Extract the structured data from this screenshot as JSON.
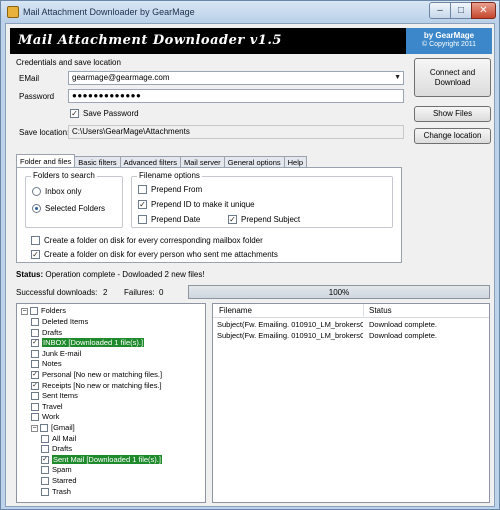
{
  "window": {
    "title": "Mail Attachment Downloader by GearMage",
    "minimize_glyph": "–",
    "maximize_glyph": "□",
    "close_glyph": "✕"
  },
  "banner": {
    "title": "Mail Attachment Downloader v1.5",
    "brand": "by GearMage",
    "copyright": "© Copyright 2011"
  },
  "credentials": {
    "section_label": "Credentials and save location",
    "email_label": "EMail",
    "email_value": "gearmage@gearmage.com",
    "password_label": "Password",
    "password_value": "●●●●●●●●●●●●●",
    "save_password_label": "Save Password",
    "save_password_checked": true,
    "save_location_label": "Save location:",
    "save_location_value": "C:\\Users\\GearMage\\Attachments"
  },
  "buttons": {
    "connect": "Connect and Download",
    "show_files": "Show Files",
    "change_location": "Change location"
  },
  "tabs": [
    {
      "label": "Folder and files",
      "active": true
    },
    {
      "label": "Basic filters",
      "active": false
    },
    {
      "label": "Advanced filters",
      "active": false
    },
    {
      "label": "Mail server",
      "active": false
    },
    {
      "label": "General options",
      "active": false
    },
    {
      "label": "Help",
      "active": false
    }
  ],
  "folders_to_search": {
    "title": "Folders to search",
    "options": [
      "Inbox only",
      "Selected Folders"
    ],
    "selected": "Selected Folders"
  },
  "filename_options": {
    "title": "Filename options",
    "prepend_from": {
      "label": "Prepend From",
      "checked": false
    },
    "prepend_id": {
      "label": "Prepend ID to make it unique",
      "checked": true
    },
    "prepend_date": {
      "label": "Prepend Date",
      "checked": false
    },
    "prepend_subject": {
      "label": "Prepend Subject",
      "checked": true
    }
  },
  "folder_options": {
    "per_mailbox": {
      "label": "Create a folder on disk for every corresponding mailbox folder",
      "checked": false
    },
    "per_sender": {
      "label": "Create a folder on disk for every person who sent me attachments",
      "checked": true
    }
  },
  "status": {
    "label": "Status:",
    "text": "Operation complete - Dowloaded 2 new files!",
    "successful_label": "Successful downloads:",
    "successful_count": "2",
    "failures_label": "Failures:",
    "failures_count": "0",
    "progress_text": "100%",
    "progress_fraction": 1.0
  },
  "tree": {
    "root": "Folders",
    "expander_glyph": "−",
    "checkmark_glyph": "✓",
    "items": [
      {
        "label": "Deleted Items",
        "level": 1,
        "checked": false,
        "highlight": false
      },
      {
        "label": "Drafts",
        "level": 1,
        "checked": false,
        "highlight": false
      },
      {
        "label": "INBOX [Downloaded 1 file(s).]",
        "level": 1,
        "checked": true,
        "highlight": true
      },
      {
        "label": "Junk E-mail",
        "level": 1,
        "checked": false,
        "highlight": false
      },
      {
        "label": "Notes",
        "level": 1,
        "checked": false,
        "highlight": false
      },
      {
        "label": "Personal [No new or matching files.]",
        "level": 1,
        "checked": true,
        "highlight": false
      },
      {
        "label": "Receipts [No new or matching files.]",
        "level": 1,
        "checked": true,
        "highlight": false
      },
      {
        "label": "Sent Items",
        "level": 1,
        "checked": false,
        "highlight": false
      },
      {
        "label": "Travel",
        "level": 1,
        "checked": false,
        "highlight": false
      },
      {
        "label": "Work",
        "level": 1,
        "checked": false,
        "highlight": false
      },
      {
        "label": "[Gmail]",
        "level": 1,
        "checked": false,
        "highlight": false,
        "expandable": true
      },
      {
        "label": "All Mail",
        "level": 2,
        "checked": false,
        "highlight": false
      },
      {
        "label": "Drafts",
        "level": 2,
        "checked": false,
        "highlight": false
      },
      {
        "label": "Sent Mail [Downloaded 1 file(s).]",
        "level": 2,
        "checked": true,
        "highlight": true
      },
      {
        "label": "Spam",
        "level": 2,
        "checked": false,
        "highlight": false
      },
      {
        "label": "Starred",
        "level": 2,
        "checked": false,
        "highlight": false
      },
      {
        "label": "Trash",
        "level": 2,
        "checked": false,
        "highlight": false
      }
    ]
  },
  "files": {
    "columns": [
      "Filename",
      "Status"
    ],
    "rows": [
      [
        "Subject(Fw. Emailing. 010910_LM_brokersO...",
        "Download complete."
      ],
      [
        "Subject(Fw. Emailing. 010910_LM_brokersO...",
        "Download complete."
      ]
    ]
  },
  "colors": {
    "highlight": "#1f8a2c",
    "badge": "#3b87c9",
    "banner": "#000000"
  }
}
